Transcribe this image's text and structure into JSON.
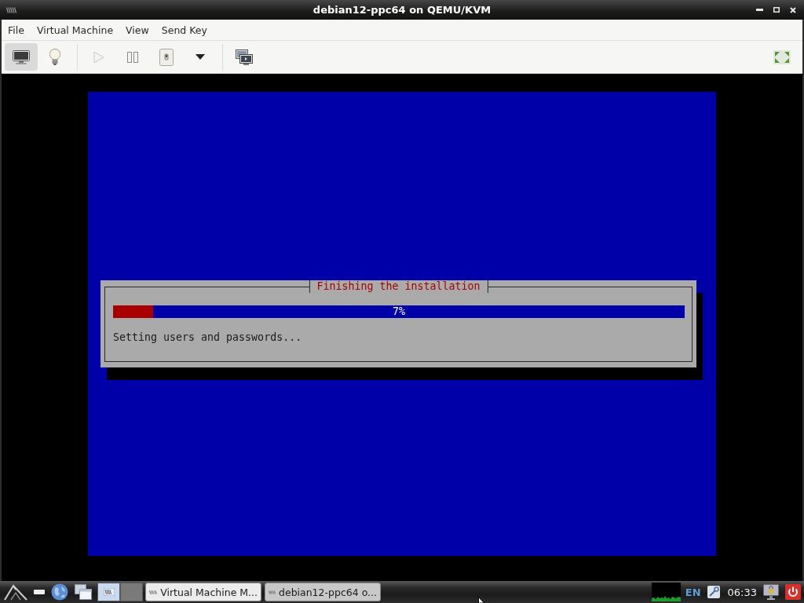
{
  "window": {
    "title": "debian12-ppc64 on QEMU/KVM"
  },
  "menu_bar": {
    "items": [
      "File",
      "Virtual Machine",
      "View",
      "Send Key"
    ]
  },
  "toolbar": {
    "groups": [
      {
        "buttons": [
          {
            "kind": "console",
            "selected": true,
            "disabled": false
          },
          {
            "kind": "details",
            "selected": false,
            "disabled": false
          }
        ]
      },
      {
        "buttons": [
          {
            "kind": "run",
            "selected": false,
            "disabled": true
          },
          {
            "kind": "pause",
            "selected": false,
            "disabled": false
          },
          {
            "kind": "shutdown",
            "selected": false,
            "disabled": false
          },
          {
            "kind": "shutdown_menu",
            "selected": false,
            "disabled": false
          }
        ]
      },
      {
        "buttons": [
          {
            "kind": "snapshots",
            "selected": false,
            "disabled": false
          }
        ]
      }
    ],
    "end_buttons": [
      {
        "kind": "fullscreen",
        "selected": false,
        "disabled": false
      }
    ]
  },
  "console": {
    "dialog": {
      "title": "Finishing the installation",
      "progress": {
        "level": 0.07,
        "reading": "7%"
      },
      "status": "Setting users and passwords..."
    }
  },
  "taskbar": {
    "launchers": [
      {
        "kind": "menu"
      },
      {
        "kind": "desktop"
      },
      {
        "kind": "browser"
      },
      {
        "kind": "files"
      }
    ],
    "pager": {
      "desktops": [
        {
          "selected": true,
          "occupied": true
        },
        {
          "selected": false,
          "occupied": false
        }
      ]
    },
    "tasks": [
      {
        "label": "Virtual Machine M...",
        "selected": false
      },
      {
        "label": "debian12-ppc64 o...",
        "selected": true
      }
    ],
    "tray": {
      "keyboard_layout": "EN",
      "clock": "06:33"
    }
  }
}
